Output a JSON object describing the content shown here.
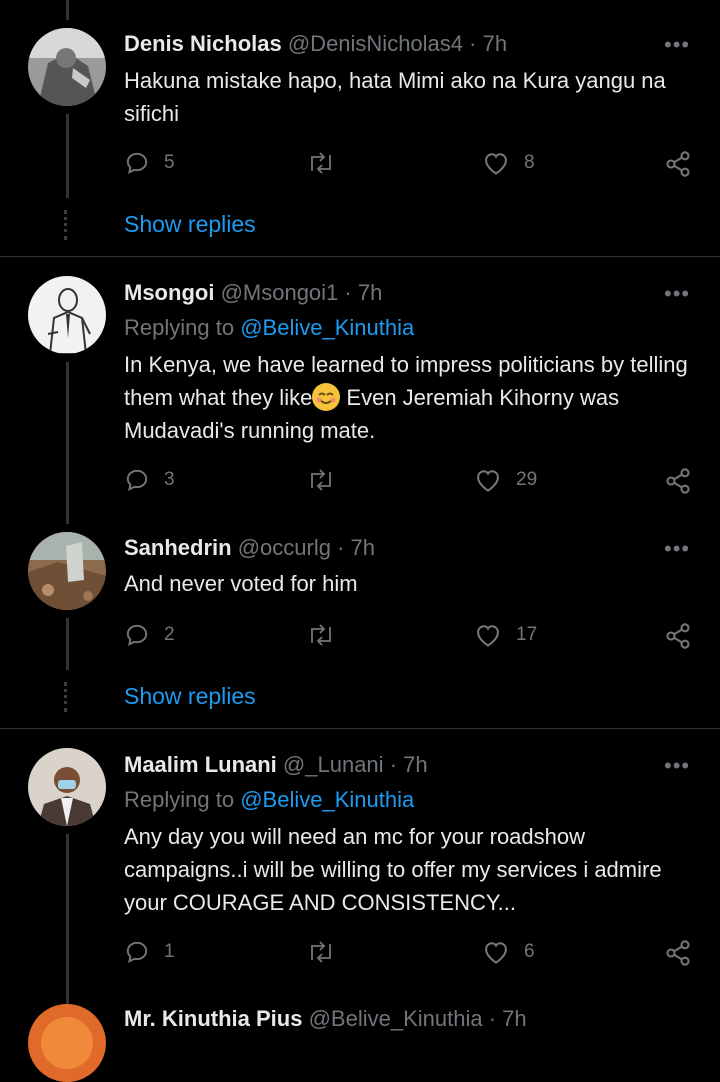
{
  "tweets": [
    {
      "name": "Denis Nicholas",
      "handle": "@DenisNicholas4",
      "time": "· 7h",
      "replying_prefix": "",
      "replying_handle": "",
      "text": "Hakuna mistake hapo, hata Mimi ako na Kura yangu na sifichi",
      "replies": "5",
      "retweets": "",
      "likes": "8",
      "avatar_icon": "portrait-bw-avatar"
    },
    {
      "name": "Msongoi",
      "handle": "@Msongoi1",
      "time": "· 7h",
      "replying_prefix": "Replying to",
      "replying_handle": "@Belive_Kinuthia",
      "text_before_emoji": "In Kenya, we have learned to  impress politicians by telling them what they like",
      "text_after_emoji": " Even Jeremiah Kihorny was Mudavadi's running mate.",
      "emoji_icon": "smiling-face-emoji",
      "replies": "3",
      "retweets": "",
      "likes": "29",
      "avatar_icon": "sketch-man-avatar"
    },
    {
      "name": "Sanhedrin",
      "handle": "@occurlg",
      "time": "· 7h",
      "text": "And never voted for him",
      "replies": "2",
      "retweets": "",
      "likes": "17",
      "avatar_icon": "painting-avatar"
    },
    {
      "name": "Maalim Lunani",
      "handle": "@_Lunani",
      "time": "· 7h",
      "replying_prefix": "Replying to",
      "replying_handle": "@Belive_Kinuthia",
      "text": "Any day you will need an mc for your roadshow campaigns..i will be willing to offer my services i admire your COURAGE AND CONSISTENCY...",
      "replies": "1",
      "retweets": "",
      "likes": "6",
      "avatar_icon": "masked-man-avatar"
    },
    {
      "name": "Mr. Kinuthia Pius",
      "handle": "@Belive_Kinuthia",
      "time": "· 7h",
      "avatar_icon": "orange-avatar"
    }
  ],
  "show_replies_label": "Show replies",
  "more_label": "•••",
  "colors": {
    "background": "#000000",
    "text": "#e7e9ea",
    "muted": "#71767b",
    "link": "#1d9bf0",
    "divider": "#2f3336"
  }
}
